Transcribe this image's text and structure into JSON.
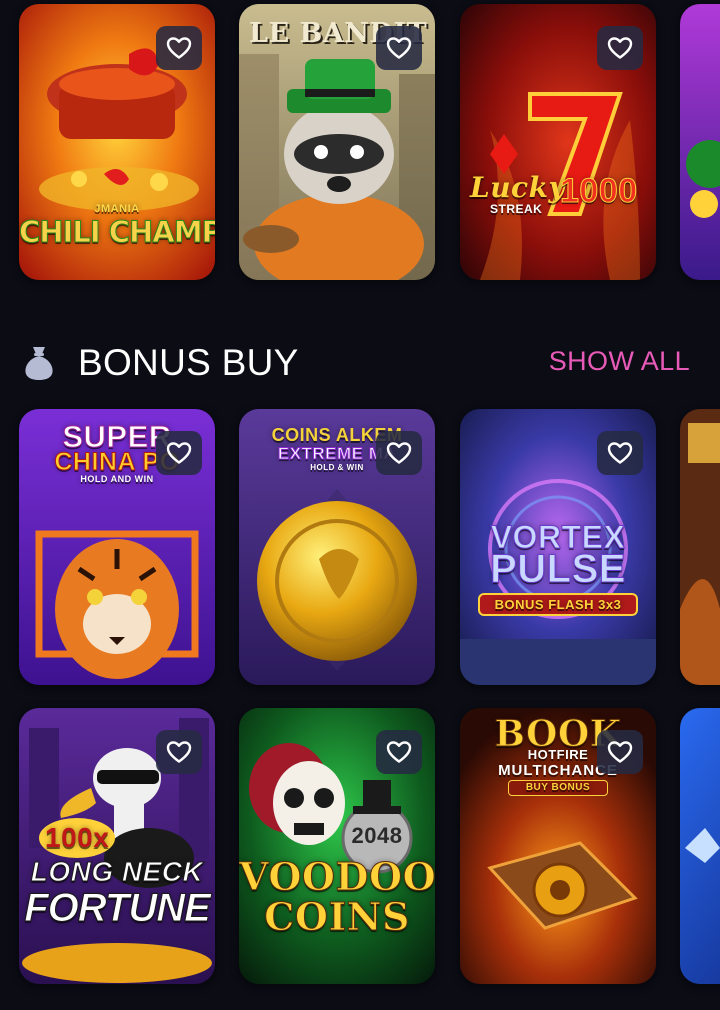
{
  "colors": {
    "background": "#0b0c14",
    "accent": "#e85ab8",
    "favorite_button_bg": "#262a42",
    "title": "#ffffff"
  },
  "top_row": {
    "games": [
      {
        "title_line1": "JMANIA",
        "title_line2": "CHILI CHAMPS",
        "icon": "heart-icon"
      },
      {
        "title_line1": "LE BANDIT",
        "title_line2": "",
        "icon": "heart-icon"
      },
      {
        "title_line1": "Lucky",
        "title_line2": "STREAK",
        "title_line3": "1000",
        "icon": "heart-icon"
      },
      {
        "title_line1": "",
        "title_line2": "",
        "icon": "heart-icon"
      }
    ]
  },
  "bonus_buy": {
    "icon": "money-bag-icon",
    "title": "BONUS BUY",
    "show_all_label": "SHOW ALL",
    "games": [
      {
        "title_line1": "SUPER",
        "title_line2": "CHINA PO",
        "title_line3": "HOLD AND WIN",
        "icon": "heart-icon"
      },
      {
        "title_line1": "COINS ALKEM",
        "title_line2": "EXTREME MA",
        "title_line3": "HOLD & WIN",
        "icon": "heart-icon"
      },
      {
        "title_line1": "VORTEX",
        "title_line2": "PULSE",
        "title_line3": "BONUS FLASH 3x3",
        "icon": "heart-icon"
      },
      {
        "title_line1": "",
        "title_line2": "",
        "icon": "heart-icon"
      },
      {
        "title_line1": "100x",
        "title_line2": "LONG NECK",
        "title_line3": "FORTUNE",
        "icon": "heart-icon"
      },
      {
        "title_line1": "2048",
        "title_line2": "VOODOO",
        "title_line3": "COINS",
        "icon": "heart-icon"
      },
      {
        "title_line1": "BOOK",
        "title_line2": "HOTFIRE",
        "title_line3": "MULTICHANCE",
        "title_line4": "BUY BONUS",
        "icon": "heart-icon"
      },
      {
        "title_line1": "",
        "title_line2": "",
        "icon": "heart-icon"
      }
    ]
  }
}
